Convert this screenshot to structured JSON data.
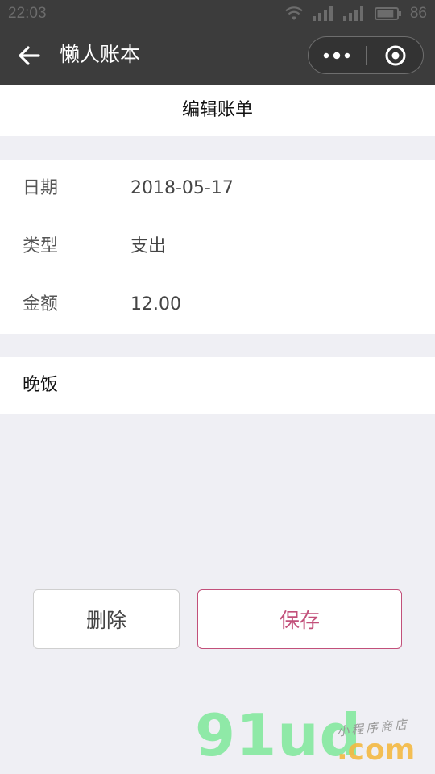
{
  "status_bar": {
    "time": "22:03",
    "battery": "86",
    "battery_level": 0.86
  },
  "nav": {
    "title": "懒人账本",
    "menu_icon": "more-dots-icon",
    "close_icon": "target-circle-icon"
  },
  "page": {
    "title": "编辑账单"
  },
  "form": {
    "rows": [
      {
        "label": "日期",
        "value": "2018-05-17"
      },
      {
        "label": "类型",
        "value": "支出"
      },
      {
        "label": "金额",
        "value": "12.00"
      }
    ]
  },
  "note": {
    "text": "晚饭"
  },
  "actions": {
    "delete_label": "删除",
    "save_label": "保存"
  },
  "watermark": {
    "main": "91ud",
    "domain": ".com",
    "caption": "小程序商店"
  },
  "colors": {
    "accent": "#c2507a",
    "nav_background": "#3c3c3c",
    "page_background": "#efeff4"
  }
}
